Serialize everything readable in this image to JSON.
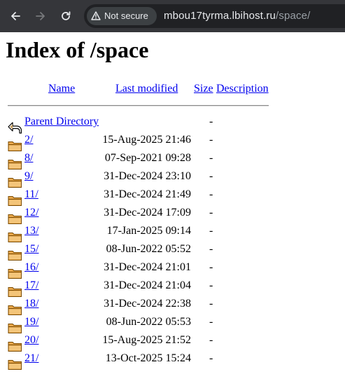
{
  "browser": {
    "security_label": "Not secure",
    "url_host": "mbou17tyrma.lbihost.ru",
    "url_path": "/space/"
  },
  "page": {
    "title": "Index of /space",
    "columns": {
      "name": "Name",
      "modified": "Last modified",
      "size": "Size",
      "description": "Description"
    }
  },
  "entries": [
    {
      "name": "Parent Directory",
      "modified": "",
      "size": "-",
      "icon": "back-icon"
    },
    {
      "name": "2/",
      "modified": "15-Aug-2025 21:46",
      "size": "-",
      "icon": "folder-icon"
    },
    {
      "name": "8/",
      "modified": "07-Sep-2021 09:28",
      "size": "-",
      "icon": "folder-icon"
    },
    {
      "name": "9/",
      "modified": "31-Dec-2024 23:10",
      "size": "-",
      "icon": "folder-icon"
    },
    {
      "name": "11/",
      "modified": "31-Dec-2024 21:49",
      "size": "-",
      "icon": "folder-icon"
    },
    {
      "name": "12/",
      "modified": "31-Dec-2024 17:09",
      "size": "-",
      "icon": "folder-icon"
    },
    {
      "name": "13/",
      "modified": "17-Jan-2025 09:14",
      "size": "-",
      "icon": "folder-icon"
    },
    {
      "name": "15/",
      "modified": "08-Jun-2022 05:52",
      "size": "-",
      "icon": "folder-icon"
    },
    {
      "name": "16/",
      "modified": "31-Dec-2024 21:01",
      "size": "-",
      "icon": "folder-icon"
    },
    {
      "name": "17/",
      "modified": "31-Dec-2024 21:04",
      "size": "-",
      "icon": "folder-icon"
    },
    {
      "name": "18/",
      "modified": "31-Dec-2024 22:38",
      "size": "-",
      "icon": "folder-icon"
    },
    {
      "name": "19/",
      "modified": "08-Jun-2022 05:53",
      "size": "-",
      "icon": "folder-icon"
    },
    {
      "name": "20/",
      "modified": "15-Aug-2025 21:52",
      "size": "-",
      "icon": "folder-icon"
    },
    {
      "name": "21/",
      "modified": "13-Oct-2025 15:24",
      "size": "-",
      "icon": "folder-icon"
    }
  ]
}
